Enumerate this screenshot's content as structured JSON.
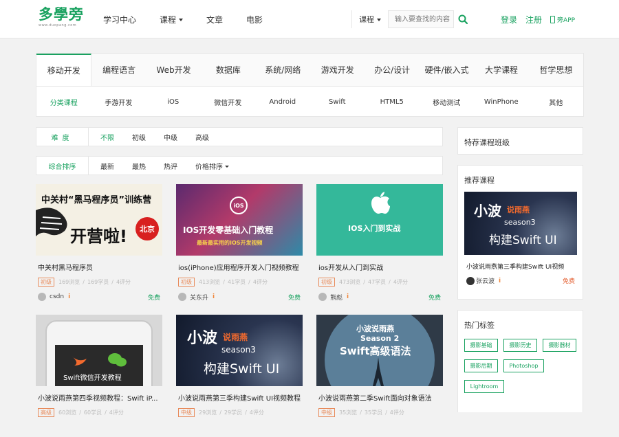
{
  "header": {
    "logo_text": "多學旁",
    "logo_sub": "www.duopang.com",
    "nav": [
      {
        "label": "学习中心"
      },
      {
        "label": "课程"
      },
      {
        "label": "文章"
      },
      {
        "label": "电影"
      }
    ],
    "search": {
      "category": "课程",
      "placeholder": "输入要查找的内容"
    },
    "login": "登录",
    "register": "注册",
    "app": "旁APP"
  },
  "categories": {
    "tabs": [
      "移动开发",
      "编程语言",
      "Web开发",
      "数据库",
      "系统/网络",
      "游戏开发",
      "办公/设计",
      "硬件/嵌入式",
      "大学课程",
      "哲学思想"
    ],
    "subs": [
      "分类课程",
      "手游开发",
      "iOS",
      "微信开发",
      "Android",
      "Swift",
      "HTML5",
      "移动测试",
      "WinPhone",
      "其他"
    ]
  },
  "filters": {
    "difficulty_label": "难度",
    "difficulty": [
      "不限",
      "初级",
      "中级",
      "高级"
    ],
    "sort": [
      "综合排序",
      "最新",
      "最热",
      "热评",
      "价格排序"
    ]
  },
  "courses": [
    {
      "title": "中关村黑马程序员",
      "level": "初级",
      "views": "169浏览",
      "learners": "169学员",
      "reviews": "4评分",
      "author": "csdn",
      "price": "免费",
      "thumb": {
        "line1": "中关村“黑马程序员”训练营",
        "line2": "开营啦!",
        "badge": "北京"
      }
    },
    {
      "title": "ios(iPhone)应用程序开发入门视频教程",
      "level": "初级",
      "views": "413浏览",
      "learners": "41学员",
      "reviews": "4评分",
      "author": "关东升",
      "price": "免费",
      "thumb": {
        "line1": "IOS开发零基础入门教程",
        "line2": "最新最实用的IOS开发视频",
        "badge": "iOS"
      }
    },
    {
      "title": "ios开发从入门到实战",
      "level": "初级",
      "views": "473浏览",
      "learners": "47学员",
      "reviews": "4评分",
      "author": "熊彪",
      "price": "免费",
      "thumb": {
        "line1": "IOS入门到实战"
      }
    },
    {
      "title": "小波说雨燕第四季视频教程：Swift iP...",
      "level": "高级",
      "views": "60浏览",
      "learners": "60学员",
      "reviews": "4评分",
      "thumb": {
        "line1": "Swift微信开发教程"
      }
    },
    {
      "title": "小波说雨燕第三季构建Swift UI视频教程",
      "level": "中级",
      "views": "29浏览",
      "learners": "29学员",
      "reviews": "4评分",
      "thumb": {
        "line1": "小波",
        "line2": "说雨燕",
        "line3": "season3",
        "line4": "构建Swift UI"
      }
    },
    {
      "title": "小波说雨燕第二季Swift面向对象语法",
      "level": "中级",
      "views": "35浏览",
      "learners": "35学员",
      "reviews": "4评分",
      "thumb": {
        "line1": "小波说雨燕",
        "line2": "Season 2",
        "line3": "Swift高级语法"
      }
    }
  ],
  "sidebar": {
    "featured_title": "特荐课程班级",
    "recommend_title": "推荐课程",
    "recommend": {
      "title": "小波说雨燕第三季构建Swift UI视频",
      "author": "张云波",
      "price": "免费",
      "thumb": {
        "line1": "小波",
        "line2": "说雨燕",
        "line3": "season3",
        "line4": "构建Swift UI"
      }
    },
    "tags_title": "热门标签",
    "tags": [
      "摄影基础",
      "摄影历史",
      "摄影器材",
      "摄影后期",
      "Photoshop",
      "Lightroom"
    ]
  },
  "colors": {
    "accent": "#1aa260",
    "level": "#e88a5a",
    "free_red": "#e5663a"
  }
}
